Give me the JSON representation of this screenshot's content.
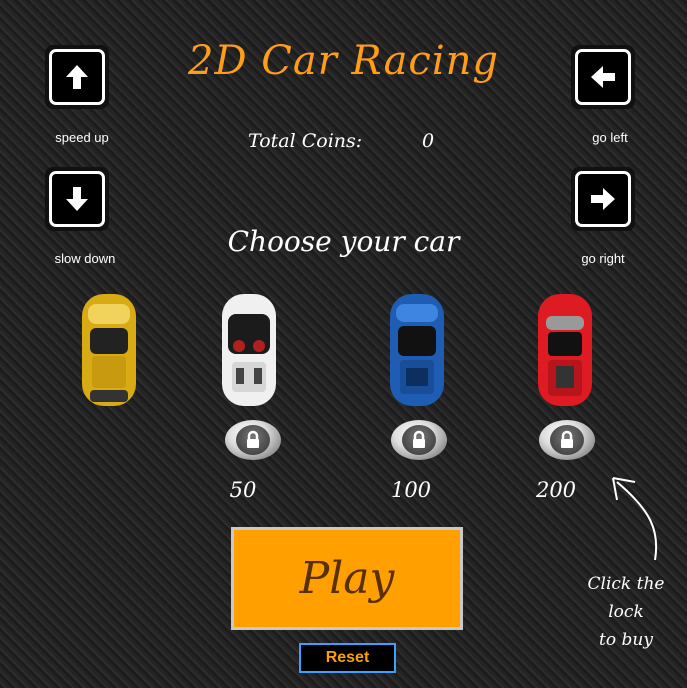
{
  "title": "2D Car Racing",
  "controls": {
    "speed_up": "speed up",
    "slow_down": "slow down",
    "go_left": "go left",
    "go_right": "go right"
  },
  "coins": {
    "label": "Total Coins:",
    "value": "0"
  },
  "choose_label": "Choose your car",
  "cars": [
    {
      "color": "#e0b320",
      "name": "yellow",
      "locked": false
    },
    {
      "color": "#f2f2f2",
      "name": "white",
      "locked": true,
      "price": "50"
    },
    {
      "color": "#1f5fb8",
      "name": "blue",
      "locked": true,
      "price": "100"
    },
    {
      "color": "#e01b24",
      "name": "red",
      "locked": true,
      "price": "200"
    }
  ],
  "play_label": "Play",
  "reset_label": "Reset",
  "hint": {
    "line1": "Click the",
    "line2": "lock",
    "line3": "to buy"
  },
  "colors": {
    "accent": "#ff9f00",
    "title": "#ff9c1a",
    "reset_border": "#3ba0ff"
  }
}
